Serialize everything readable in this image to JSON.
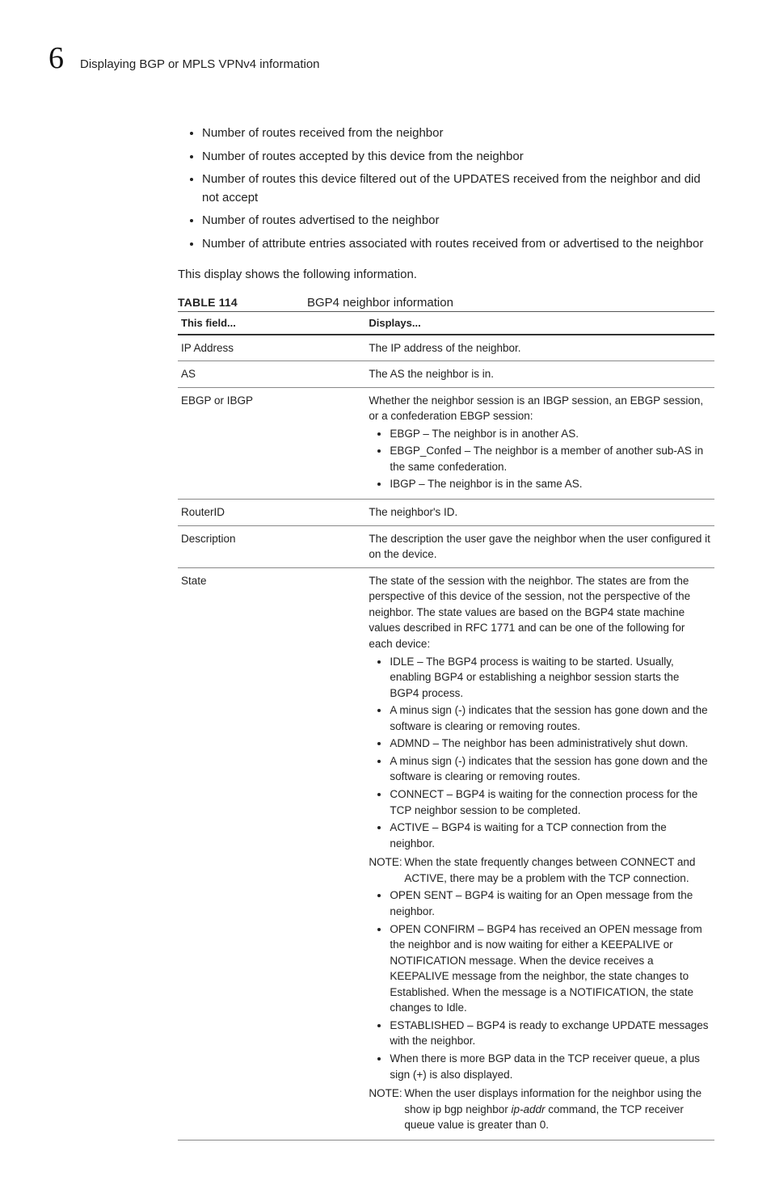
{
  "header": {
    "chapter": "6",
    "section": "Displaying BGP or MPLS VPNv4 information"
  },
  "intro_bullets": [
    "Number of routes received from the neighbor",
    "Number of routes accepted by this device from the neighbor",
    "Number of routes this device filtered out of the UPDATES received from the neighbor and did not accept",
    "Number of routes advertised to the neighbor",
    "Number of attribute entries associated with routes received from or advertised to the neighbor"
  ],
  "intro_para": "This display shows the following information.",
  "table_label": "TABLE 114",
  "table_title": "BGP4 neighbor information",
  "thead": {
    "c1": "This field...",
    "c2": "Displays..."
  },
  "rows": {
    "ip": {
      "f": "IP Address",
      "d": "The IP address of the neighbor."
    },
    "as": {
      "f": "AS",
      "d": "The AS the neighbor is in."
    },
    "ebgp": {
      "f": "EBGP or IBGP",
      "d": "Whether the neighbor session is an IBGP session, an EBGP session, or a confederation EBGP session:",
      "items": [
        "EBGP – The neighbor is in another AS.",
        "EBGP_Confed – The neighbor is a member of another sub-AS in the same confederation.",
        "IBGP – The neighbor is in the same AS."
      ]
    },
    "routerid": {
      "f": "RouterID",
      "d": "The neighbor's ID."
    },
    "desc": {
      "f": "Description",
      "d": "The description the user gave the neighbor when the user configured it on the device."
    },
    "state": {
      "f": "State",
      "d": "The state of the session with the neighbor. The states are from the perspective of this device of the session, not the perspective of the neighbor. The state values are based on the BGP4 state machine values described in RFC 1771 and can be one of the following for each device:",
      "items1": [
        "IDLE – The BGP4 process is waiting to be started. Usually, enabling BGP4 or establishing a neighbor session starts the BGP4 process.",
        "A minus sign (-) indicates that the session has gone down and the software is clearing or removing routes.",
        "ADMND – The neighbor has been administratively shut down.",
        "A minus sign (-) indicates that the session has gone down and the software is clearing or removing routes.",
        "CONNECT – BGP4 is waiting for the connection process for the TCP neighbor session to be completed.",
        "ACTIVE – BGP4 is waiting for a TCP connection from the neighbor."
      ],
      "note1_label": "NOTE:",
      "note1_text": "When the state frequently changes between CONNECT and ACTIVE, there may be a problem with the TCP connection.",
      "items2": [
        "OPEN SENT – BGP4 is waiting for an Open message from the neighbor.",
        "OPEN CONFIRM – BGP4 has received an OPEN message from the neighbor and is now waiting for either a KEEPALIVE or NOTIFICATION message. When the device receives a KEEPALIVE message from the neighbor, the state changes to Established. When the message is a NOTIFICATION, the state changes to Idle.",
        "ESTABLISHED – BGP4 is ready to exchange UPDATE messages with the neighbor.",
        "When there is more BGP data in the TCP receiver queue, a plus sign (+) is also displayed."
      ],
      "note2_label": "NOTE:",
      "note2_pre": "When the user displays information for the neighbor using the show ip bgp neighbor ",
      "note2_emph": "ip-addr",
      "note2_post": " command, the TCP receiver queue value is greater than 0."
    }
  }
}
